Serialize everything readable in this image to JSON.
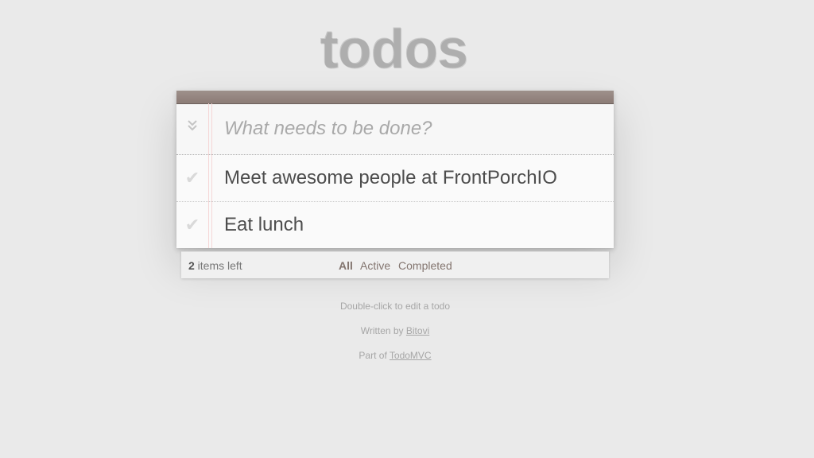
{
  "app": {
    "title": "todos"
  },
  "new_todo": {
    "placeholder": "What needs to be done?",
    "value": ""
  },
  "todos": [
    {
      "title": "Meet awesome people at FrontPorchIO",
      "completed": false
    },
    {
      "title": "Eat lunch",
      "completed": false
    }
  ],
  "footer": {
    "count": "2",
    "count_suffix": " items left",
    "filters": [
      "All",
      "Active",
      "Completed"
    ],
    "selected_filter": "All"
  },
  "info": {
    "hint": "Double-click to edit a todo",
    "written_prefix": "Written by ",
    "author": "Bitovi",
    "part_prefix": "Part of ",
    "project": "TodoMVC"
  },
  "icons": {
    "toggle_all": "double-chevron-down-icon",
    "check": "checkmark-icon"
  },
  "colors": {
    "header_bar": "#8d7d77",
    "background": "#eaeaea",
    "margin_line": "#f5d6d6"
  }
}
